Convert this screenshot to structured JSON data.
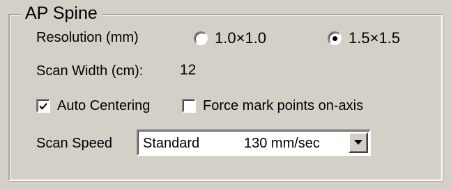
{
  "group": {
    "title": "AP Spine"
  },
  "resolution": {
    "label": "Resolution (mm)",
    "options": [
      {
        "label": "1.0×1.0",
        "selected": false
      },
      {
        "label": "1.5×1.5",
        "selected": true
      }
    ]
  },
  "scan_width": {
    "label": "Scan Width (cm):",
    "value": "12"
  },
  "options": {
    "auto_centering": {
      "label": "Auto Centering",
      "checked": true
    },
    "force_mark_points": {
      "label": "Force mark points on-axis",
      "checked": false
    }
  },
  "scan_speed": {
    "label": "Scan Speed",
    "selected_value": "Standard",
    "selected_rate": "130 mm/sec"
  },
  "icons": {
    "dropdown": "chevron-down-icon",
    "check": "checkmark-icon"
  },
  "colors": {
    "window_bg": "#d4d0c8",
    "field_bg": "#ffffff"
  }
}
